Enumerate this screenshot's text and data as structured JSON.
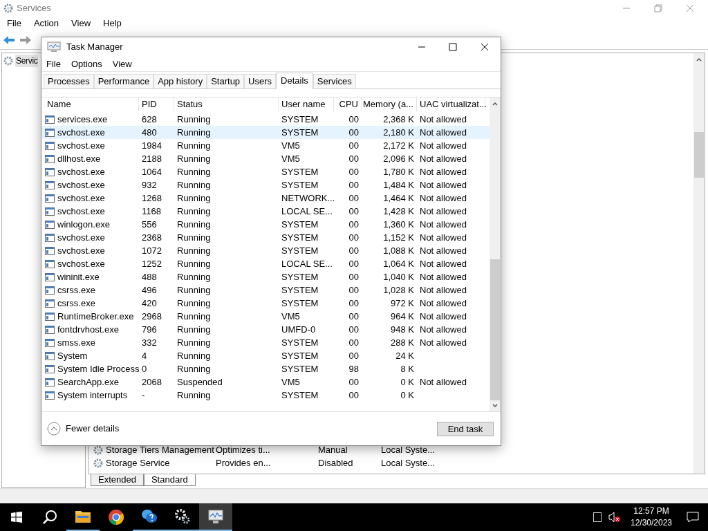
{
  "services_window": {
    "title": "Services",
    "menu": [
      "File",
      "Action",
      "View",
      "Help"
    ],
    "tree_item": "Servic",
    "rows": [
      {
        "name": "Storage Tiers Management",
        "description": "Optimizes ti...",
        "startup": "Manual",
        "log_on_as": "Local Syste..."
      },
      {
        "name": "Storage Service",
        "description": "Provides en...",
        "startup": "Disabled",
        "log_on_as": "Local Syste..."
      }
    ],
    "tabs": [
      {
        "label": "Extended",
        "selected": false
      },
      {
        "label": "Standard",
        "selected": true
      }
    ]
  },
  "task_manager": {
    "title": "Task Manager",
    "menu": [
      "File",
      "Options",
      "View"
    ],
    "tabs": [
      {
        "label": "Processes",
        "selected": false
      },
      {
        "label": "Performance",
        "selected": false
      },
      {
        "label": "App history",
        "selected": false
      },
      {
        "label": "Startup",
        "selected": false
      },
      {
        "label": "Users",
        "selected": false
      },
      {
        "label": "Details",
        "selected": true
      },
      {
        "label": "Services",
        "selected": false
      }
    ],
    "columns": [
      "Name",
      "PID",
      "Status",
      "User name",
      "CPU",
      "Memory (a...",
      "UAC virtualizat..."
    ],
    "rows": [
      {
        "cells": [
          "services.exe",
          "628",
          "Running",
          "SYSTEM",
          "00",
          "2,368 K",
          "Not allowed"
        ],
        "selected": false
      },
      {
        "cells": [
          "svchost.exe",
          "480",
          "Running",
          "SYSTEM",
          "00",
          "2,180 K",
          "Not allowed"
        ],
        "selected": true
      },
      {
        "cells": [
          "svchost.exe",
          "1984",
          "Running",
          "VM5",
          "00",
          "2,172 K",
          "Not allowed"
        ],
        "selected": false
      },
      {
        "cells": [
          "dllhost.exe",
          "2188",
          "Running",
          "VM5",
          "00",
          "2,096 K",
          "Not allowed"
        ],
        "selected": false
      },
      {
        "cells": [
          "svchost.exe",
          "1064",
          "Running",
          "SYSTEM",
          "00",
          "1,780 K",
          "Not allowed"
        ],
        "selected": false
      },
      {
        "cells": [
          "svchost.exe",
          "932",
          "Running",
          "SYSTEM",
          "00",
          "1,484 K",
          "Not allowed"
        ],
        "selected": false
      },
      {
        "cells": [
          "svchost.exe",
          "1268",
          "Running",
          "NETWORK...",
          "00",
          "1,464 K",
          "Not allowed"
        ],
        "selected": false
      },
      {
        "cells": [
          "svchost.exe",
          "1168",
          "Running",
          "LOCAL SE...",
          "00",
          "1,428 K",
          "Not allowed"
        ],
        "selected": false
      },
      {
        "cells": [
          "winlogon.exe",
          "556",
          "Running",
          "SYSTEM",
          "00",
          "1,360 K",
          "Not allowed"
        ],
        "selected": false
      },
      {
        "cells": [
          "svchost.exe",
          "2368",
          "Running",
          "SYSTEM",
          "00",
          "1,152 K",
          "Not allowed"
        ],
        "selected": false
      },
      {
        "cells": [
          "svchost.exe",
          "1072",
          "Running",
          "SYSTEM",
          "00",
          "1,088 K",
          "Not allowed"
        ],
        "selected": false
      },
      {
        "cells": [
          "svchost.exe",
          "1252",
          "Running",
          "LOCAL SE...",
          "00",
          "1,064 K",
          "Not allowed"
        ],
        "selected": false
      },
      {
        "cells": [
          "wininit.exe",
          "488",
          "Running",
          "SYSTEM",
          "00",
          "1,040 K",
          "Not allowed"
        ],
        "selected": false
      },
      {
        "cells": [
          "csrss.exe",
          "496",
          "Running",
          "SYSTEM",
          "00",
          "1,028 K",
          "Not allowed"
        ],
        "selected": false
      },
      {
        "cells": [
          "csrss.exe",
          "420",
          "Running",
          "SYSTEM",
          "00",
          "972 K",
          "Not allowed"
        ],
        "selected": false
      },
      {
        "cells": [
          "RuntimeBroker.exe",
          "2968",
          "Running",
          "VM5",
          "00",
          "964 K",
          "Not allowed"
        ],
        "selected": false
      },
      {
        "cells": [
          "fontdrvhost.exe",
          "796",
          "Running",
          "UMFD-0",
          "00",
          "948 K",
          "Not allowed"
        ],
        "selected": false
      },
      {
        "cells": [
          "smss.exe",
          "332",
          "Running",
          "SYSTEM",
          "00",
          "288 K",
          "Not allowed"
        ],
        "selected": false
      },
      {
        "cells": [
          "System",
          "4",
          "Running",
          "SYSTEM",
          "00",
          "24 K"
        ],
        "selected": false
      },
      {
        "cells": [
          "System Idle Process",
          "0",
          "Running",
          "SYSTEM",
          "98",
          "8 K"
        ],
        "selected": false
      },
      {
        "cells": [
          "SearchApp.exe",
          "2068",
          "Suspended",
          "VM5",
          "00",
          "0 K",
          "Not allowed"
        ],
        "selected": false
      },
      {
        "cells": [
          "System interrupts",
          "-",
          "Running",
          "SYSTEM",
          "00",
          "0 K"
        ],
        "selected": false
      }
    ],
    "fewer_details": "Fewer details",
    "end_task": "End task"
  },
  "taskbar": {
    "time": "12:57 PM",
    "date": "12/30/2023"
  }
}
